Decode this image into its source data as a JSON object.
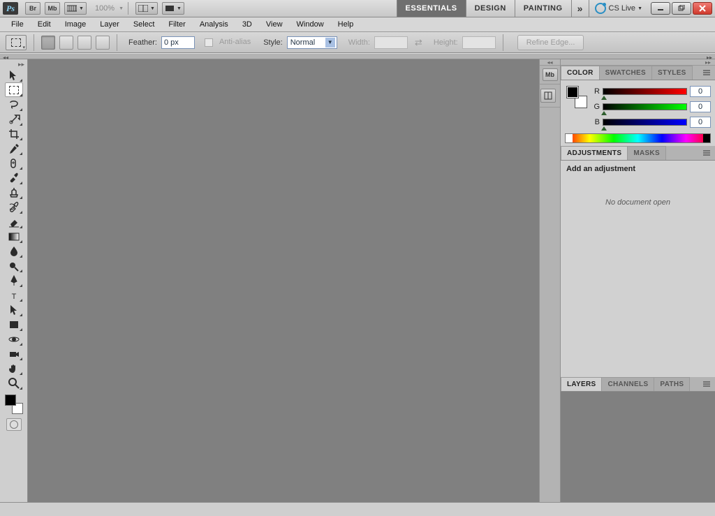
{
  "appbar": {
    "zoom": "100%",
    "workspaces": [
      "ESSENTIALS",
      "DESIGN",
      "PAINTING"
    ],
    "active_workspace": 0,
    "cslive": "CS Live"
  },
  "menubar": [
    "File",
    "Edit",
    "Image",
    "Layer",
    "Select",
    "Filter",
    "Analysis",
    "3D",
    "View",
    "Window",
    "Help"
  ],
  "options": {
    "feather_label": "Feather:",
    "feather_value": "0 px",
    "antialias_label": "Anti-alias",
    "style_label": "Style:",
    "style_value": "Normal",
    "width_label": "Width:",
    "width_value": "",
    "height_label": "Height:",
    "height_value": "",
    "refine_label": "Refine Edge..."
  },
  "color_panel": {
    "tabs": [
      "COLOR",
      "SWATCHES",
      "STYLES"
    ],
    "active": 0,
    "r_label": "R",
    "r_value": "0",
    "g_label": "G",
    "g_value": "0",
    "b_label": "B",
    "b_value": "0"
  },
  "adjustments_panel": {
    "tabs": [
      "ADJUSTMENTS",
      "MASKS"
    ],
    "active": 0,
    "heading": "Add an adjustment",
    "empty": "No document open"
  },
  "layers_panel": {
    "tabs": [
      "LAYERS",
      "CHANNELS",
      "PATHS"
    ],
    "active": 0
  },
  "dock_chips": {
    "mb": "Mb"
  }
}
